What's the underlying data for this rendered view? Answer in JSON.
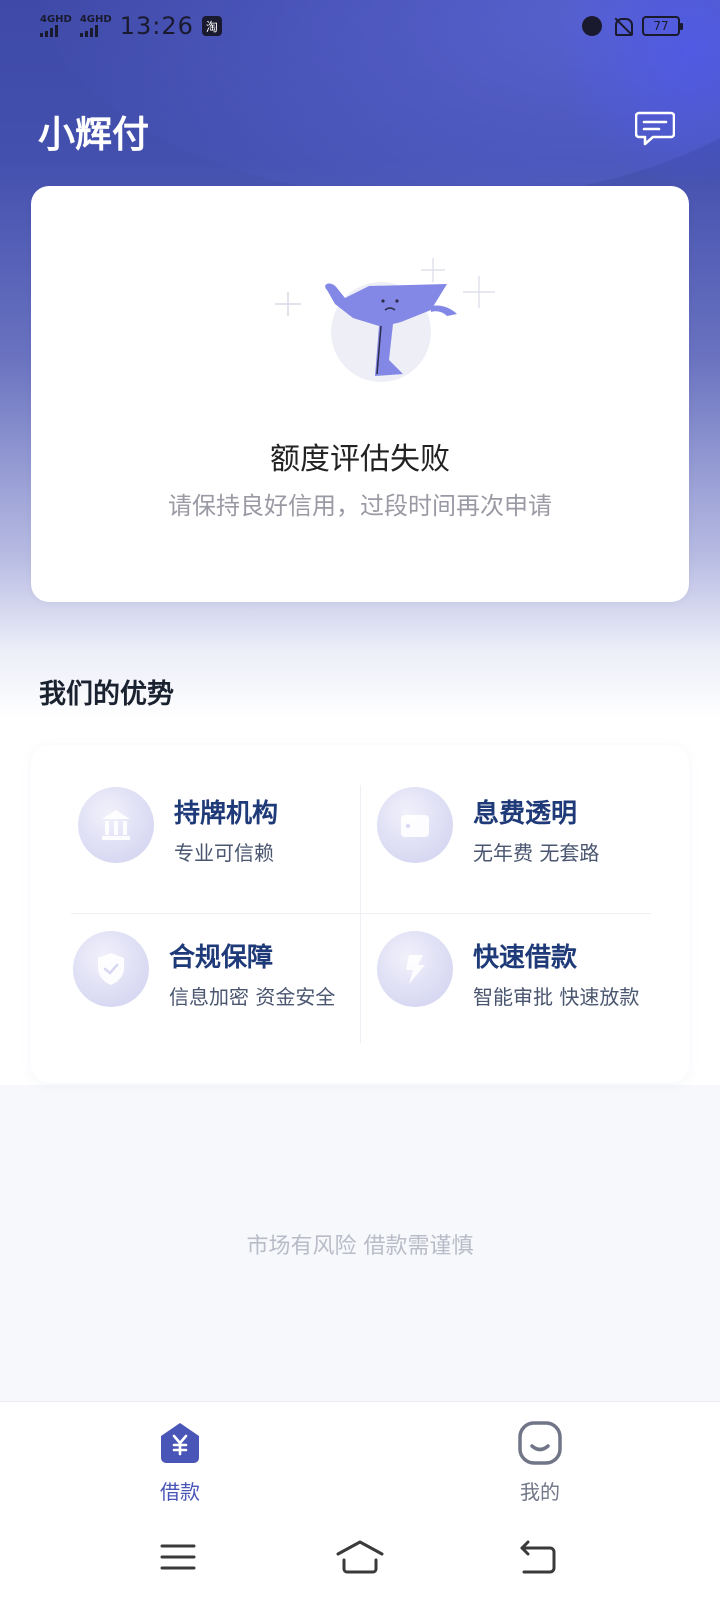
{
  "status_bar": {
    "signal_1_label": "4GHD",
    "signal_2_label": "4GHD",
    "time": "13:26",
    "app_badge": "淘",
    "battery": "77"
  },
  "header": {
    "title": "小辉付",
    "message_icon": "message-icon"
  },
  "result": {
    "title": "额度评估失败",
    "subtitle": "请保持良好信用，过段时间再次申请"
  },
  "advantages": {
    "section_title": "我们的优势",
    "items": [
      {
        "icon": "bank-icon",
        "name": "持牌机构",
        "desc": "专业可信赖"
      },
      {
        "icon": "wallet-icon",
        "name": "息费透明",
        "desc": "无年费 无套路"
      },
      {
        "icon": "shield-icon",
        "name": "合规保障",
        "desc": "信息加密 资金安全"
      },
      {
        "icon": "lightning-icon",
        "name": "快速借款",
        "desc": "智能审批 快速放款"
      }
    ]
  },
  "risk_note": "市场有风险 借款需谨慎",
  "bottom_nav": {
    "items": [
      {
        "label": "借款",
        "icon": "yuan-house-icon",
        "active": true
      },
      {
        "label": "我的",
        "icon": "smile-face-icon",
        "active": false
      }
    ],
    "active_color": "#4a55b8",
    "inactive_color": "#707687"
  },
  "system_nav": [
    "menu-icon",
    "home-icon",
    "back-icon"
  ]
}
